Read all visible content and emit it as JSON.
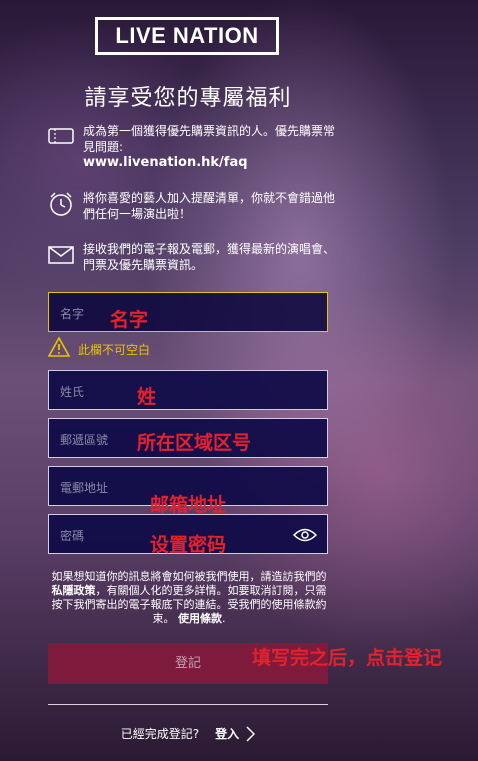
{
  "brand": {
    "logo_text": "LIVE NATION"
  },
  "page": {
    "title": "請享受您的專屬福利"
  },
  "benefits": [
    {
      "icon": "ticket-icon",
      "text": "成為第一個獲得優先購票資訊的人。優先購票常見問題:",
      "link": "www.livenation.hk/faq"
    },
    {
      "icon": "alarm-clock-icon",
      "text": "將你喜愛的藝人加入提醒清單，你就不會錯過他們任何一場演出啦！"
    },
    {
      "icon": "envelope-icon",
      "text": "接收我們的電子報及電郵，獲得最新的演唱會、門票及優先購票資訊。"
    }
  ],
  "form": {
    "first_name": {
      "placeholder": "名字",
      "annotation": "名字"
    },
    "error_text": "此欄不可空白",
    "last_name": {
      "placeholder": "姓氏",
      "annotation": "姓"
    },
    "postal_code": {
      "placeholder": "郵遞區號",
      "annotation": "所在区域区号"
    },
    "email": {
      "placeholder": "電郵地址",
      "annotation": "邮箱地址"
    },
    "password": {
      "placeholder": "密碼",
      "annotation": "设置密码"
    }
  },
  "privacy": {
    "part1": "如果想知道你的訊息將會如何被我們使用，請造訪我們的",
    "policy_link": "私隱政策",
    "part2": "，有關個人化的更多詳情。如要取消訂閱，只需按下我們寄出的電子報底下的連結。受我們的",
    "terms_text": "使用條款約束。",
    "terms_link": "使用條款",
    "end": "."
  },
  "submit": {
    "label": "登記",
    "annotation": "填写完之后，点击登记"
  },
  "footer": {
    "question": "已經完成登記?",
    "login_label": "登入"
  }
}
